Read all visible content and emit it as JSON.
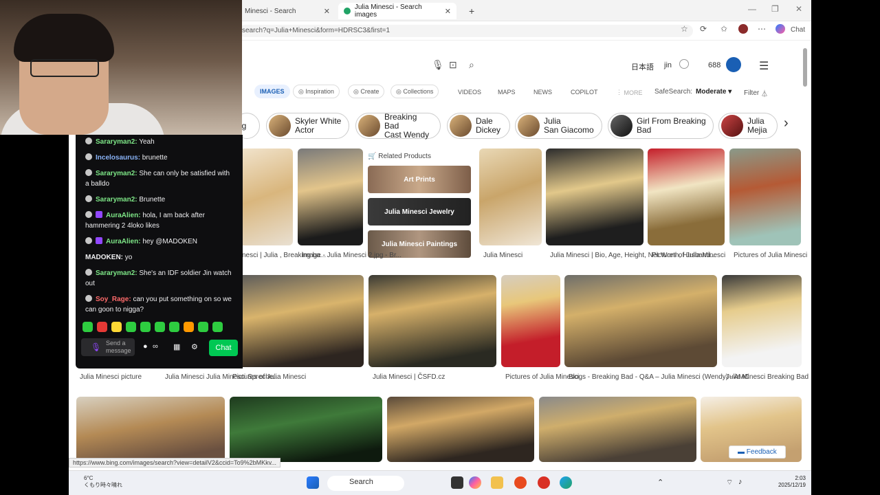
{
  "browser": {
    "tabs": [
      {
        "title": "Minesci - Search"
      },
      {
        "title": "Julia Minesci - Search images"
      }
    ],
    "url": "search?q=Julia+Minesci&form=HDRSC3&first=1",
    "chat_button": "Chat",
    "status_url": "https://www.bing.com/images/search?view=detailV2&ccid=To9%2bMKkv..."
  },
  "header": {
    "language": "日本語",
    "user": "jin",
    "points": "688"
  },
  "nav": {
    "images": "IMAGES",
    "inspiration": "Inspiration",
    "create": "Create",
    "collections": "Collections",
    "videos": "VIDEOS",
    "maps": "MAPS",
    "news": "NEWS",
    "copilot": "COPILOT",
    "more": "MORE",
    "safesearch_label": "SafeSearch:",
    "safesearch_value": "Moderate",
    "filter": "Filter"
  },
  "chips": [
    {
      "label": "ng"
    },
    {
      "label": "Skyler White\nActor"
    },
    {
      "label": "Breaking Bad\nCast Wendy"
    },
    {
      "label": "Dale\nDickey"
    },
    {
      "label": "Julia\nSan Giacomo"
    },
    {
      "label": "Girl From Breaking\nBad"
    },
    {
      "label": "Julia\nMejia"
    }
  ],
  "related": {
    "title": "Related Products",
    "items": [
      "Art Prints",
      "Julia Minesci Jewelry",
      "Julia Minesci Paintings"
    ]
  },
  "row1_captions": [
    "nesci | Julia\n, Breaking ba...",
    "Image - Julia\nMinesci 2.jpg - Br...",
    "Julia Minesci",
    "Julia Minesci | Bio, Age,\nHeight, Net Worth, Husband...",
    "Pictures of Julia\nMinesci",
    "Pictures of Julia\nMinesci"
  ],
  "row2_captions": [
    "Julia Minesci picture",
    "Julia Minesci Julia\nMinesci Spreche...",
    "Pictures of Julia Minesci",
    "Julia Minesci | ČSFD.cz",
    "Pictures of Julia\nMinesci",
    "Blogs - Breaking Bad - Q&A – Julia Minesci\n(Wendy) - AMC",
    "Julia Minesci Breaking\nBad"
  ],
  "feedback": "Feedback",
  "chat": {
    "messages": [
      {
        "user": "Sararyman2:",
        "text": " Yeah",
        "color": "#7ee787",
        "pur": false
      },
      {
        "user": "Incelosaurus:",
        "text": " brunette",
        "color": "#8ab4f8",
        "pur": false
      },
      {
        "user": "Sararyman2:",
        "text": " She can only be satisfied with a balldo",
        "color": "#7ee787",
        "pur": false
      },
      {
        "user": "Sararyman2:",
        "text": " Brunette",
        "color": "#7ee787",
        "pur": false
      },
      {
        "user": "AuraAlien:",
        "text": " hola, I am back after hammering 2 4loko likes",
        "color": "#7ee787",
        "pur": true
      },
      {
        "user": "AuraAlien:",
        "text": " hey @MADOKEN",
        "color": "#7ee787",
        "pur": true
      },
      {
        "user": "MADOKEN:",
        "text": " yo",
        "color": "#efeff1",
        "pur": false,
        "nobadge": true
      },
      {
        "user": "Sararyman2:",
        "text": " She's an IDF soldier Jin watch out",
        "color": "#7ee787",
        "pur": false
      },
      {
        "user": "Soy_Rage:",
        "text": " can you put something on so we can goon to nigga?",
        "color": "#ff6b6b",
        "pur": false
      }
    ],
    "input_placeholder": "Send a message",
    "send_button": "Chat",
    "points": "∞"
  },
  "taskbar": {
    "weather_temp": "6°C",
    "weather_desc": "くもり時々晴れ",
    "search": "Search",
    "time": "2:03",
    "date": "2025/12/19"
  }
}
